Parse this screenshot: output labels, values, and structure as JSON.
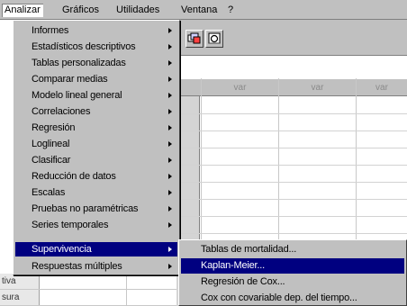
{
  "menubar": {
    "items": [
      {
        "label": "Analizar",
        "open": true
      },
      {
        "label": "Gráficos",
        "open": false
      },
      {
        "label": "Utilidades",
        "open": false
      },
      {
        "label": "Ventana",
        "open": false
      },
      {
        "label": "?",
        "open": false
      }
    ]
  },
  "grid": {
    "columns": [
      "var",
      "var",
      "var"
    ]
  },
  "behind_rows": [
    "tiva",
    "sura"
  ],
  "analizar_menu": {
    "items": [
      {
        "label": "Informes",
        "submenu": true
      },
      {
        "label": "Estadísticos descriptivos",
        "submenu": true
      },
      {
        "label": "Tablas personalizadas",
        "submenu": true
      },
      {
        "label": "Comparar medias",
        "submenu": true
      },
      {
        "label": "Modelo lineal general",
        "submenu": true
      },
      {
        "label": "Correlaciones",
        "submenu": true
      },
      {
        "label": "Regresión",
        "submenu": true
      },
      {
        "label": "Loglineal",
        "submenu": true
      },
      {
        "label": "Clasificar",
        "submenu": true
      },
      {
        "label": "Reducción de datos",
        "submenu": true
      },
      {
        "label": "Escalas",
        "submenu": true
      },
      {
        "label": "Pruebas no paramétricas",
        "submenu": true
      },
      {
        "label": "Series temporales",
        "submenu": true
      },
      {
        "label": "Supervivencia",
        "submenu": true,
        "selected": true
      },
      {
        "label": "Respuestas múltiples",
        "submenu": true
      }
    ]
  },
  "supervivencia_submenu": {
    "items": [
      {
        "label": "Tablas de mortalidad...",
        "selected": false
      },
      {
        "label": "Kaplan-Meier...",
        "selected": true
      },
      {
        "label": "Regresión de Cox...",
        "selected": false
      },
      {
        "label": "Cox con covariable dep. del tiempo...",
        "selected": false
      }
    ]
  },
  "colors": {
    "menu_face": "#c0c0c0",
    "highlight": "#000080",
    "highlight_text": "#ffffff"
  }
}
